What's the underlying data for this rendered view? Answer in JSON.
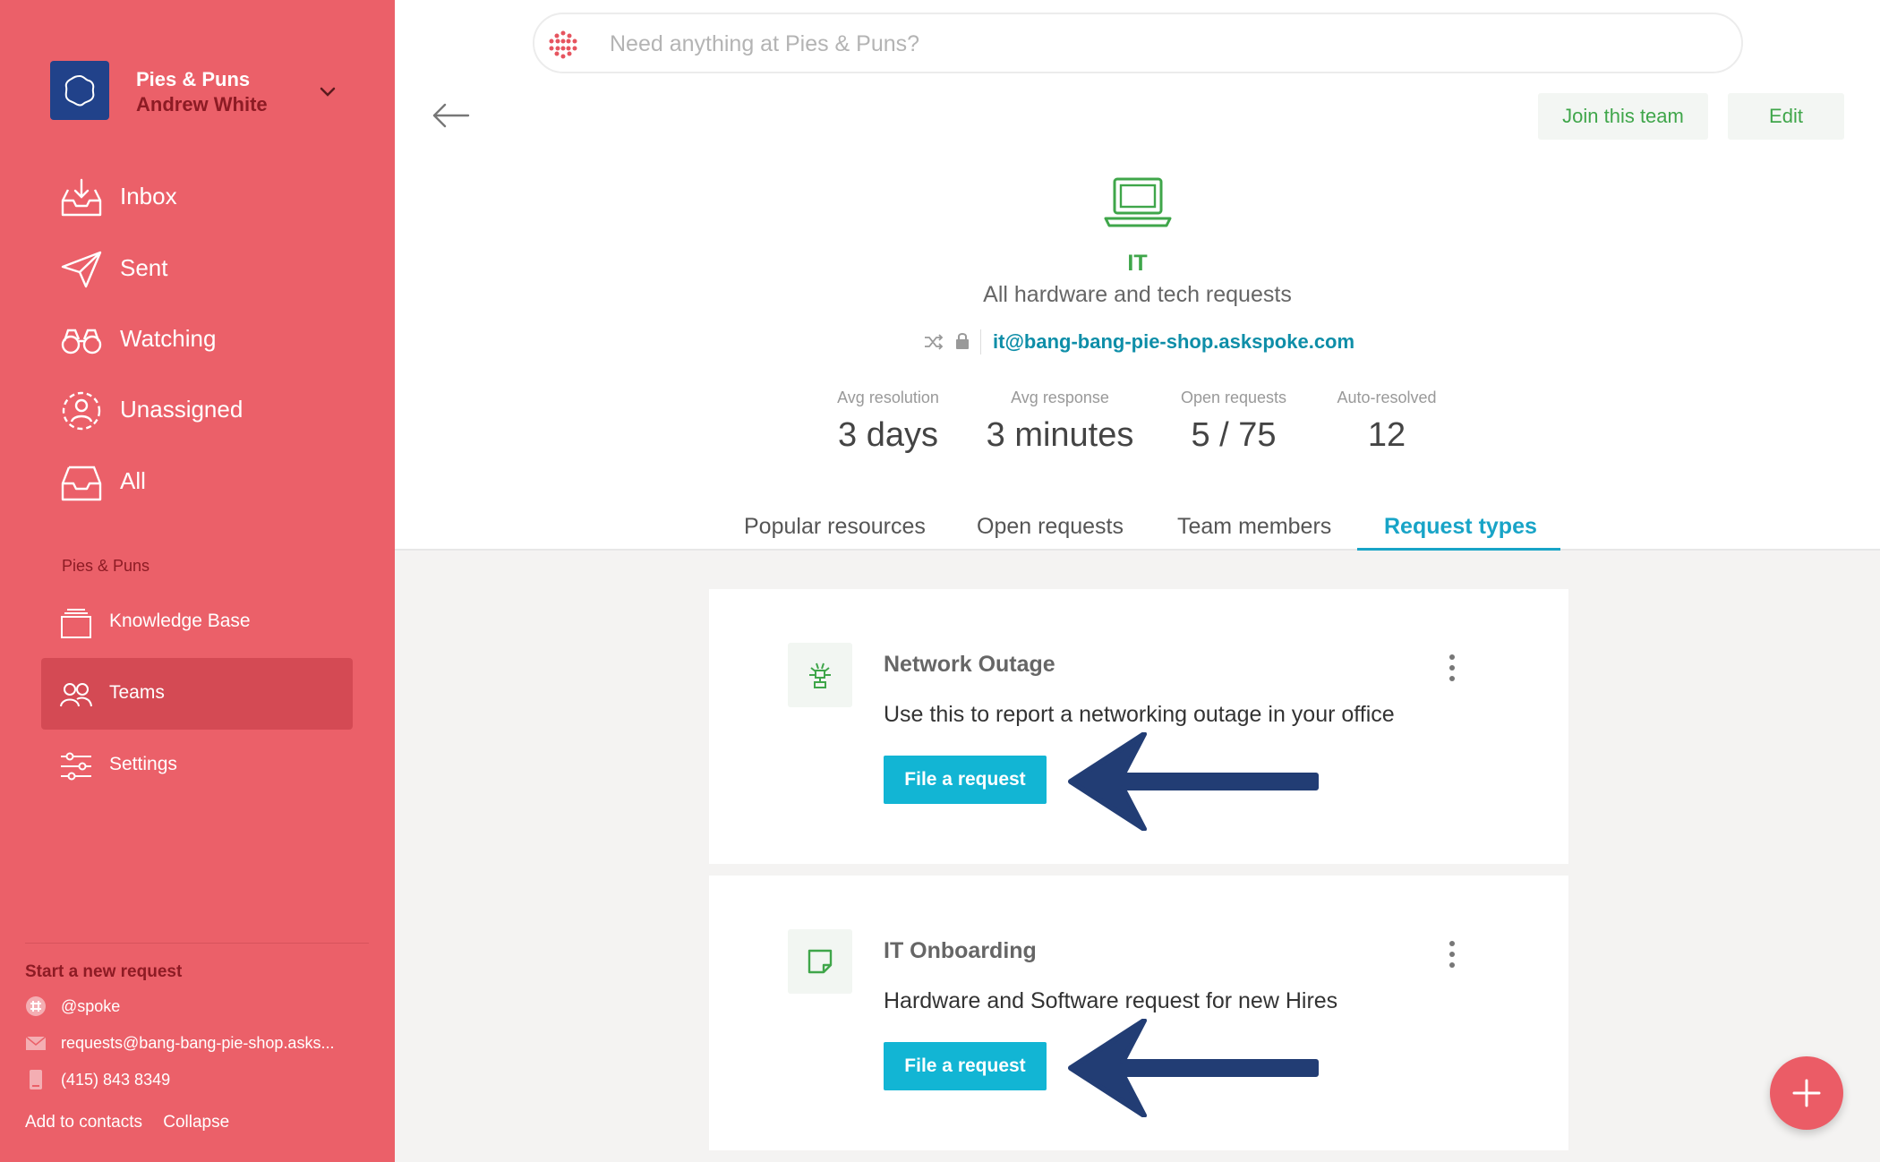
{
  "org": {
    "name": "Pies & Puns",
    "user": "Andrew White"
  },
  "nav": [
    {
      "label": "Inbox",
      "icon": "inbox-icon"
    },
    {
      "label": "Sent",
      "icon": "paper-plane-icon"
    },
    {
      "label": "Watching",
      "icon": "binoculars-icon"
    },
    {
      "label": "Unassigned",
      "icon": "unassigned-user-icon"
    },
    {
      "label": "All",
      "icon": "tray-icon"
    }
  ],
  "section_label": "Pies & Puns",
  "nav2": [
    {
      "label": "Knowledge Base",
      "icon": "knowledge-base-icon",
      "active": false
    },
    {
      "label": "Teams",
      "icon": "teams-icon",
      "active": true
    },
    {
      "label": "Settings",
      "icon": "sliders-icon",
      "active": false
    }
  ],
  "start_request": {
    "title": "Start a new request",
    "slack": "@spoke",
    "email": "requests@bang-bang-pie-shop.asks...",
    "phone": "(415) 843 8349",
    "add_contacts": "Add to contacts",
    "collapse": "Collapse"
  },
  "search": {
    "placeholder": "Need anything at Pies & Puns?"
  },
  "header": {
    "join_label": "Join this team",
    "edit_label": "Edit"
  },
  "team": {
    "name": "IT",
    "description": "All hardware and tech requests",
    "email": "it@bang-bang-pie-shop.askspoke.com"
  },
  "stats": [
    {
      "label": "Avg resolution",
      "value": "3 days"
    },
    {
      "label": "Avg response",
      "value": "3 minutes"
    },
    {
      "label": "Open requests",
      "value": "5 / 75"
    },
    {
      "label": "Auto-resolved",
      "value": "12"
    }
  ],
  "tabs": [
    {
      "label": "Popular resources",
      "active": false
    },
    {
      "label": "Open requests",
      "active": false
    },
    {
      "label": "Team members",
      "active": false
    },
    {
      "label": "Request types",
      "active": true
    }
  ],
  "request_types": [
    {
      "title": "Network Outage",
      "description": "Use this to report a networking outage in your office",
      "button": "File a request",
      "icon": "network-icon"
    },
    {
      "title": "IT Onboarding",
      "description": "Hardware and Software request for new Hires",
      "button": "File a request",
      "icon": "note-icon"
    }
  ],
  "colors": {
    "sidebar": "#eb6069",
    "accent_green": "#3fa64a",
    "accent_blue": "#18a4c7",
    "button": "#12b5d4",
    "arrow": "#223d74"
  }
}
